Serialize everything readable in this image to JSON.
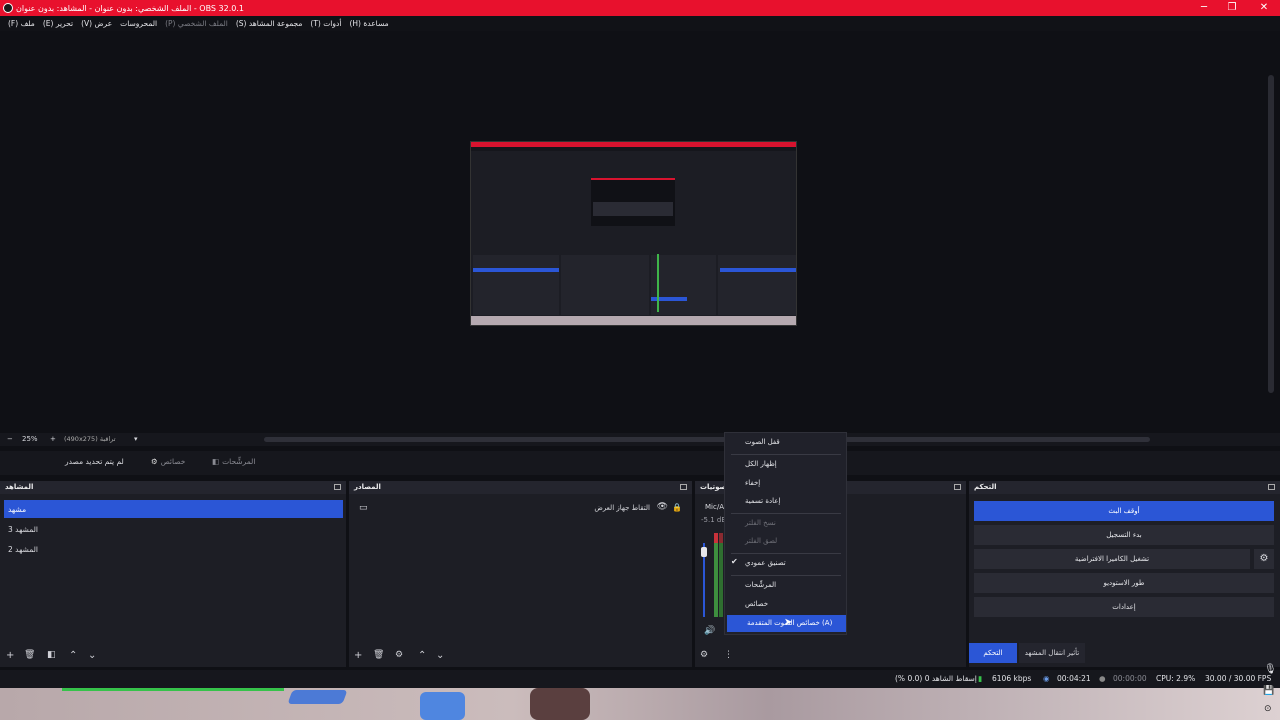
{
  "window": {
    "title": "الملف الشخصي: بدون عنوان - المشاهد: بدون عنوان - OBS 32.0.1",
    "minimize": "─",
    "maximize": "❐",
    "close": "✕"
  },
  "menu": [
    {
      "label": "(F) ملف"
    },
    {
      "label": "(E) تحرير"
    },
    {
      "label": "(V) عرض"
    },
    {
      "label": "المحروسات"
    },
    {
      "label": "(P) الملف الشخصي",
      "disabled": true
    },
    {
      "label": "(S) مجموعة المشاهد"
    },
    {
      "label": "(T) أدوات"
    },
    {
      "label": "(H) مساعدة"
    }
  ],
  "zoom": {
    "value": "25%",
    "resolution": "(490x275) تراقبة"
  },
  "toolbar": {
    "no_source": "لم يتم تحديد مصدر",
    "properties": "خصائص",
    "filters": "المرشِّحات"
  },
  "docks": {
    "scenes": {
      "title": "المشاهد",
      "items": [
        "مشهد",
        "المشهد 3",
        "المشهد 2"
      ],
      "selected": 0
    },
    "sources": {
      "title": "المصادر",
      "items": [
        {
          "label": "التقاط جهاز العرض"
        }
      ]
    },
    "mixer": {
      "title": "صوتيات",
      "track": "Mic/A",
      "level": "-5.1 dB"
    },
    "controls": {
      "title": "التحكم",
      "buttons": [
        "أوقف البث",
        "بدء التسجيل",
        "تشغيل الكاميرا الافتراضية",
        "طور الاستوديو",
        "إعدادات"
      ],
      "tabs": [
        "التحكم",
        "تأثير انتقال المشهد"
      ]
    }
  },
  "context_menu": {
    "items": [
      {
        "label": "قفل الصوت"
      },
      {
        "label": "إظهار الكل"
      },
      {
        "label": "إخفاء"
      },
      {
        "label": "إعادة تسمية"
      },
      {
        "label": "نسخ الفلتر",
        "disabled": true
      },
      {
        "label": "لصق الفلتر",
        "disabled": true
      },
      {
        "label": "تصنيق عمودي",
        "checked": true
      },
      {
        "label": "المرشِّحات"
      },
      {
        "label": "خصائص"
      },
      {
        "label": "خصائص الصوت المتقدمة (A)",
        "highlighted": true
      }
    ]
  },
  "status": {
    "dropped": "إسقاط الشاهد 0 (0.0 %)",
    "bitrate": "6106 kbps",
    "stream_time": "00:04:21",
    "rec_time": "00:00:00",
    "cpu": "CPU: 2.9%",
    "fps": "30.00 / 30.00 FPS"
  },
  "colors": {
    "accent": "#2b56d6",
    "titlebar": "#e8112d",
    "live_green": "#36c24a"
  }
}
